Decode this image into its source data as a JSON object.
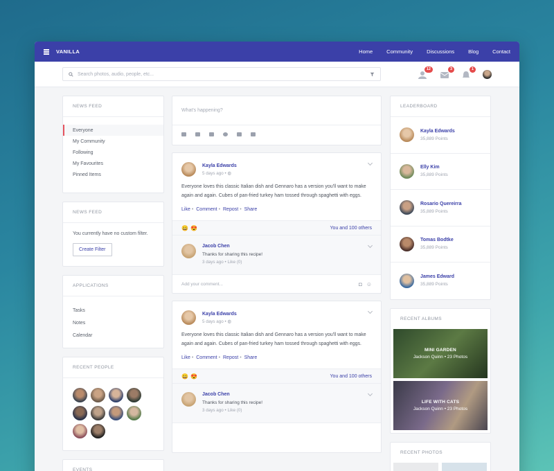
{
  "app": {
    "brand": "VANILLA"
  },
  "nav": [
    "Home",
    "Community",
    "Discussions",
    "Blog",
    "Contact"
  ],
  "search": {
    "placeholder": "Search photos, audio, people, etc..."
  },
  "notifications": {
    "people": "12",
    "messages": "3",
    "alerts": "1"
  },
  "left": {
    "news_feed_title": "NEWS FEED",
    "feed_items": [
      "Everyone",
      "My Community",
      "Following",
      "My Favourites",
      "Pinned Items"
    ],
    "news_feed2_title": "NEWS FEED",
    "no_filter_text": "You currently have no custom filter.",
    "create_filter": "Create Filter",
    "applications_title": "APPLICATIONS",
    "applications": [
      "Tasks",
      "Notes",
      "Calendar"
    ],
    "recent_people_title": "RECENT PEOPLE",
    "events_title": "EVENTS"
  },
  "composer": {
    "placeholder": "What's happening?"
  },
  "posts": [
    {
      "author": "Kayla Edwards",
      "time": "5 days ago",
      "body": "Everyone loves this classic Italian dish and Gennaro has a version you'll want to make again and again. Cubes of pan-fried turkey ham tossed through spaghetti with eggs.",
      "actions": [
        "Like",
        "Comment",
        "Repost",
        "Share"
      ],
      "reactions_text": "You and 100 others",
      "comment": {
        "author": "Jacob Chen",
        "text": "Thanks for sharing this recipe!",
        "time": "3 days ago",
        "like": "Like (0)"
      },
      "add_comment": "Add your comment..."
    },
    {
      "author": "Kayla Edwards",
      "time": "5 days ago",
      "body": "Everyone loves this classic Italian dish and Gennaro has a version you'll want to make again and again. Cubes of pan-fried turkey ham tossed through spaghetti with eggs.",
      "actions": [
        "Like",
        "Comment",
        "Repost",
        "Share"
      ],
      "reactions_text": "You and 100 others",
      "comment": {
        "author": "Jacob Chen",
        "text": "Thanks for sharing this recipe!",
        "time": "3 days ago",
        "like": "Like (0)"
      }
    }
  ],
  "right": {
    "leaderboard_title": "LEADERBOARD",
    "leaders": [
      {
        "name": "Kayla Edwards",
        "points": "35,889 Points"
      },
      {
        "name": "Elly Kim",
        "points": "35,889 Points"
      },
      {
        "name": "Rosario Quereirra",
        "points": "35,889 Points"
      },
      {
        "name": "Tomas Bodtke",
        "points": "35,889 Points"
      },
      {
        "name": "James Edward",
        "points": "35,889 Points"
      }
    ],
    "albums_title": "RECENT ALBUMS",
    "albums": [
      {
        "title": "MINI GARDEN",
        "sub": "Jackson Quinn  •  23 Photos"
      },
      {
        "title": "LIFE WITH CATS",
        "sub": "Jackson Quinn  •  23 Photos"
      }
    ],
    "photos_title": "RECENT PHOTOS"
  },
  "colors": {
    "accent": "#3b40a8",
    "badge": "#e54b4b",
    "active_marker": "#e5545f"
  }
}
